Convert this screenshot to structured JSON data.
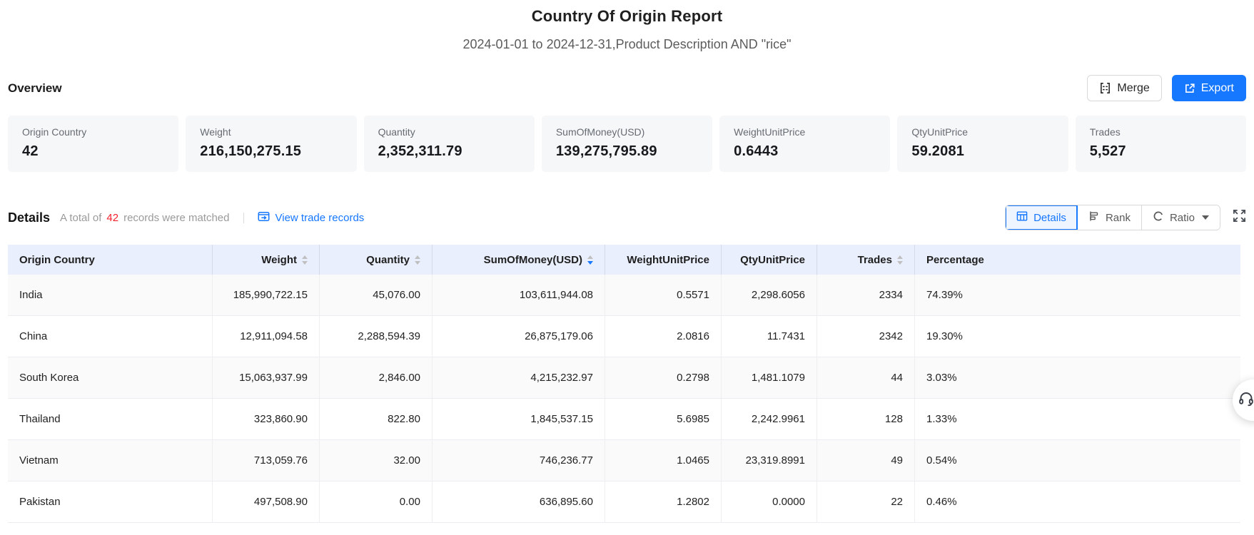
{
  "page": {
    "title": "Country Of Origin Report",
    "subtitle": "2024-01-01 to 2024-12-31,Product Description AND \"rice\""
  },
  "overview": {
    "heading": "Overview",
    "buttons": {
      "merge": "Merge",
      "export": "Export"
    },
    "cards": [
      {
        "label": "Origin Country",
        "value": "42"
      },
      {
        "label": "Weight",
        "value": "216,150,275.15"
      },
      {
        "label": "Quantity",
        "value": "2,352,311.79"
      },
      {
        "label": "SumOfMoney(USD)",
        "value": "139,275,795.89"
      },
      {
        "label": "WeightUnitPrice",
        "value": "0.6443"
      },
      {
        "label": "QtyUnitPrice",
        "value": "59.2081"
      },
      {
        "label": "Trades",
        "value": "5,527"
      }
    ]
  },
  "details": {
    "heading": "Details",
    "matched": {
      "prefix": "A total of",
      "count": "42",
      "suffix": "records were matched"
    },
    "view_trade_records": "View trade records",
    "view_buttons": [
      {
        "label": "Details",
        "active": true
      },
      {
        "label": "Rank",
        "active": false
      },
      {
        "label": "Ratio",
        "active": false,
        "dropdown": true
      }
    ]
  },
  "table": {
    "columns": [
      {
        "label": "Origin Country",
        "sortable": false,
        "align": "left"
      },
      {
        "label": "Weight",
        "sortable": true,
        "align": "right",
        "sort": "none"
      },
      {
        "label": "Quantity",
        "sortable": true,
        "align": "right",
        "sort": "none"
      },
      {
        "label": "SumOfMoney(USD)",
        "sortable": true,
        "align": "right",
        "sort": "desc"
      },
      {
        "label": "WeightUnitPrice",
        "sortable": false,
        "align": "right"
      },
      {
        "label": "QtyUnitPrice",
        "sortable": false,
        "align": "right"
      },
      {
        "label": "Trades",
        "sortable": true,
        "align": "right",
        "sort": "none"
      },
      {
        "label": "Percentage",
        "sortable": false,
        "align": "left"
      }
    ],
    "rows": [
      [
        "India",
        "185,990,722.15",
        "45,076.00",
        "103,611,944.08",
        "0.5571",
        "2,298.6056",
        "2334",
        "74.39%"
      ],
      [
        "China",
        "12,911,094.58",
        "2,288,594.39",
        "26,875,179.06",
        "2.0816",
        "11.7431",
        "2342",
        "19.30%"
      ],
      [
        "South Korea",
        "15,063,937.99",
        "2,846.00",
        "4,215,232.97",
        "0.2798",
        "1,481.1079",
        "44",
        "3.03%"
      ],
      [
        "Thailand",
        "323,860.90",
        "822.80",
        "1,845,537.15",
        "5.6985",
        "2,242.9961",
        "128",
        "1.33%"
      ],
      [
        "Vietnam",
        "713,059.76",
        "32.00",
        "746,236.77",
        "1.0465",
        "23,319.8991",
        "49",
        "0.54%"
      ],
      [
        "Pakistan",
        "497,508.90",
        "0.00",
        "636,895.60",
        "1.2802",
        "0.0000",
        "22",
        "0.46%"
      ]
    ]
  },
  "icons": {
    "merge": "merge-cells",
    "export": "external-export",
    "view_trade": "window-arrow",
    "details_tab": "table-grid",
    "rank_tab": "ranking-bars",
    "ratio_tab": "ratio-circle",
    "fullscreen": "expand-arrows",
    "support": "headset"
  },
  "colors": {
    "accent_blue": "#1677ff",
    "count_red": "#f5222d",
    "table_header_bg": "#e9effc",
    "card_bg": "#f6f7f9",
    "zebra_row_bg": "#fafafa"
  }
}
